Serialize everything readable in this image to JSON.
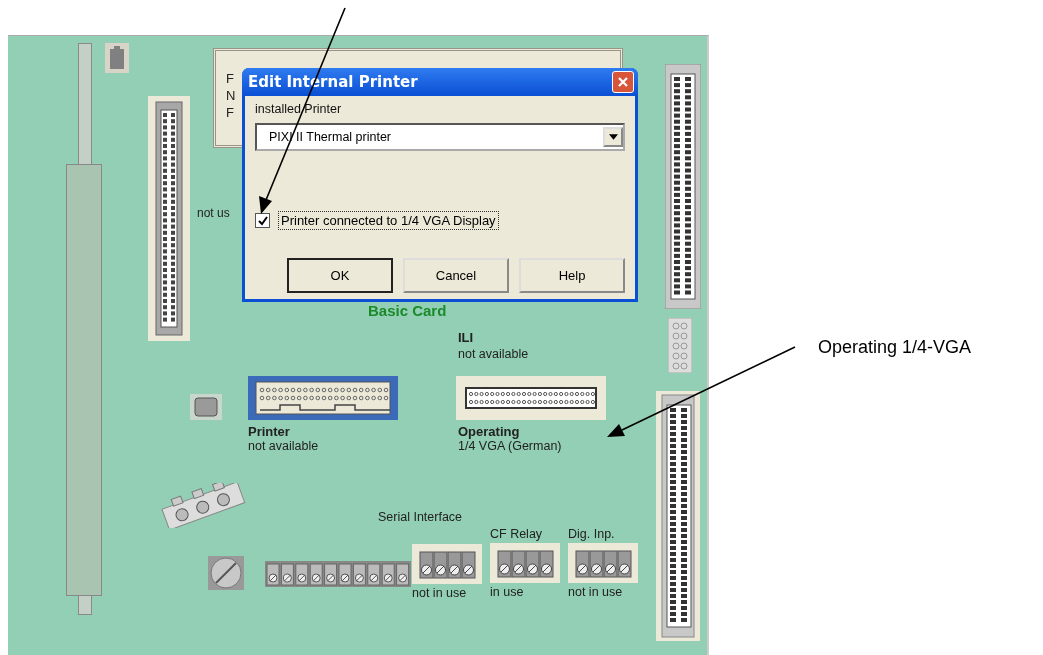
{
  "callout": "Operating 1/4-VGA",
  "board": {
    "title": "Basic Card",
    "hidden_box_letters": [
      "F",
      "N",
      "F"
    ],
    "partial_label": "not us",
    "printer_port": {
      "name": "Printer",
      "status": "not available",
      "selected": true
    },
    "ili_port": {
      "name": "ILI",
      "status": "not available"
    },
    "operating_port": {
      "name": "Operating",
      "status": "1/4 VGA (German)"
    },
    "serial_title": "Serial Interface",
    "terminals": [
      {
        "status": "not in use"
      },
      {
        "name": "CF Relay",
        "status": "in use"
      },
      {
        "name": "Dig. Inp.",
        "status": "not in use"
      }
    ]
  },
  "dialog": {
    "title": "Edit Internal Printer",
    "field_label": "installed Printer",
    "printer_value": "PIXI II Thermal printer",
    "checkbox": {
      "label": "Printer connected to 1/4 VGA Display",
      "checked": true
    },
    "buttons": [
      {
        "label": "OK",
        "default": true
      },
      {
        "label": "Cancel",
        "default": false
      },
      {
        "label": "Help",
        "default": false
      }
    ]
  }
}
